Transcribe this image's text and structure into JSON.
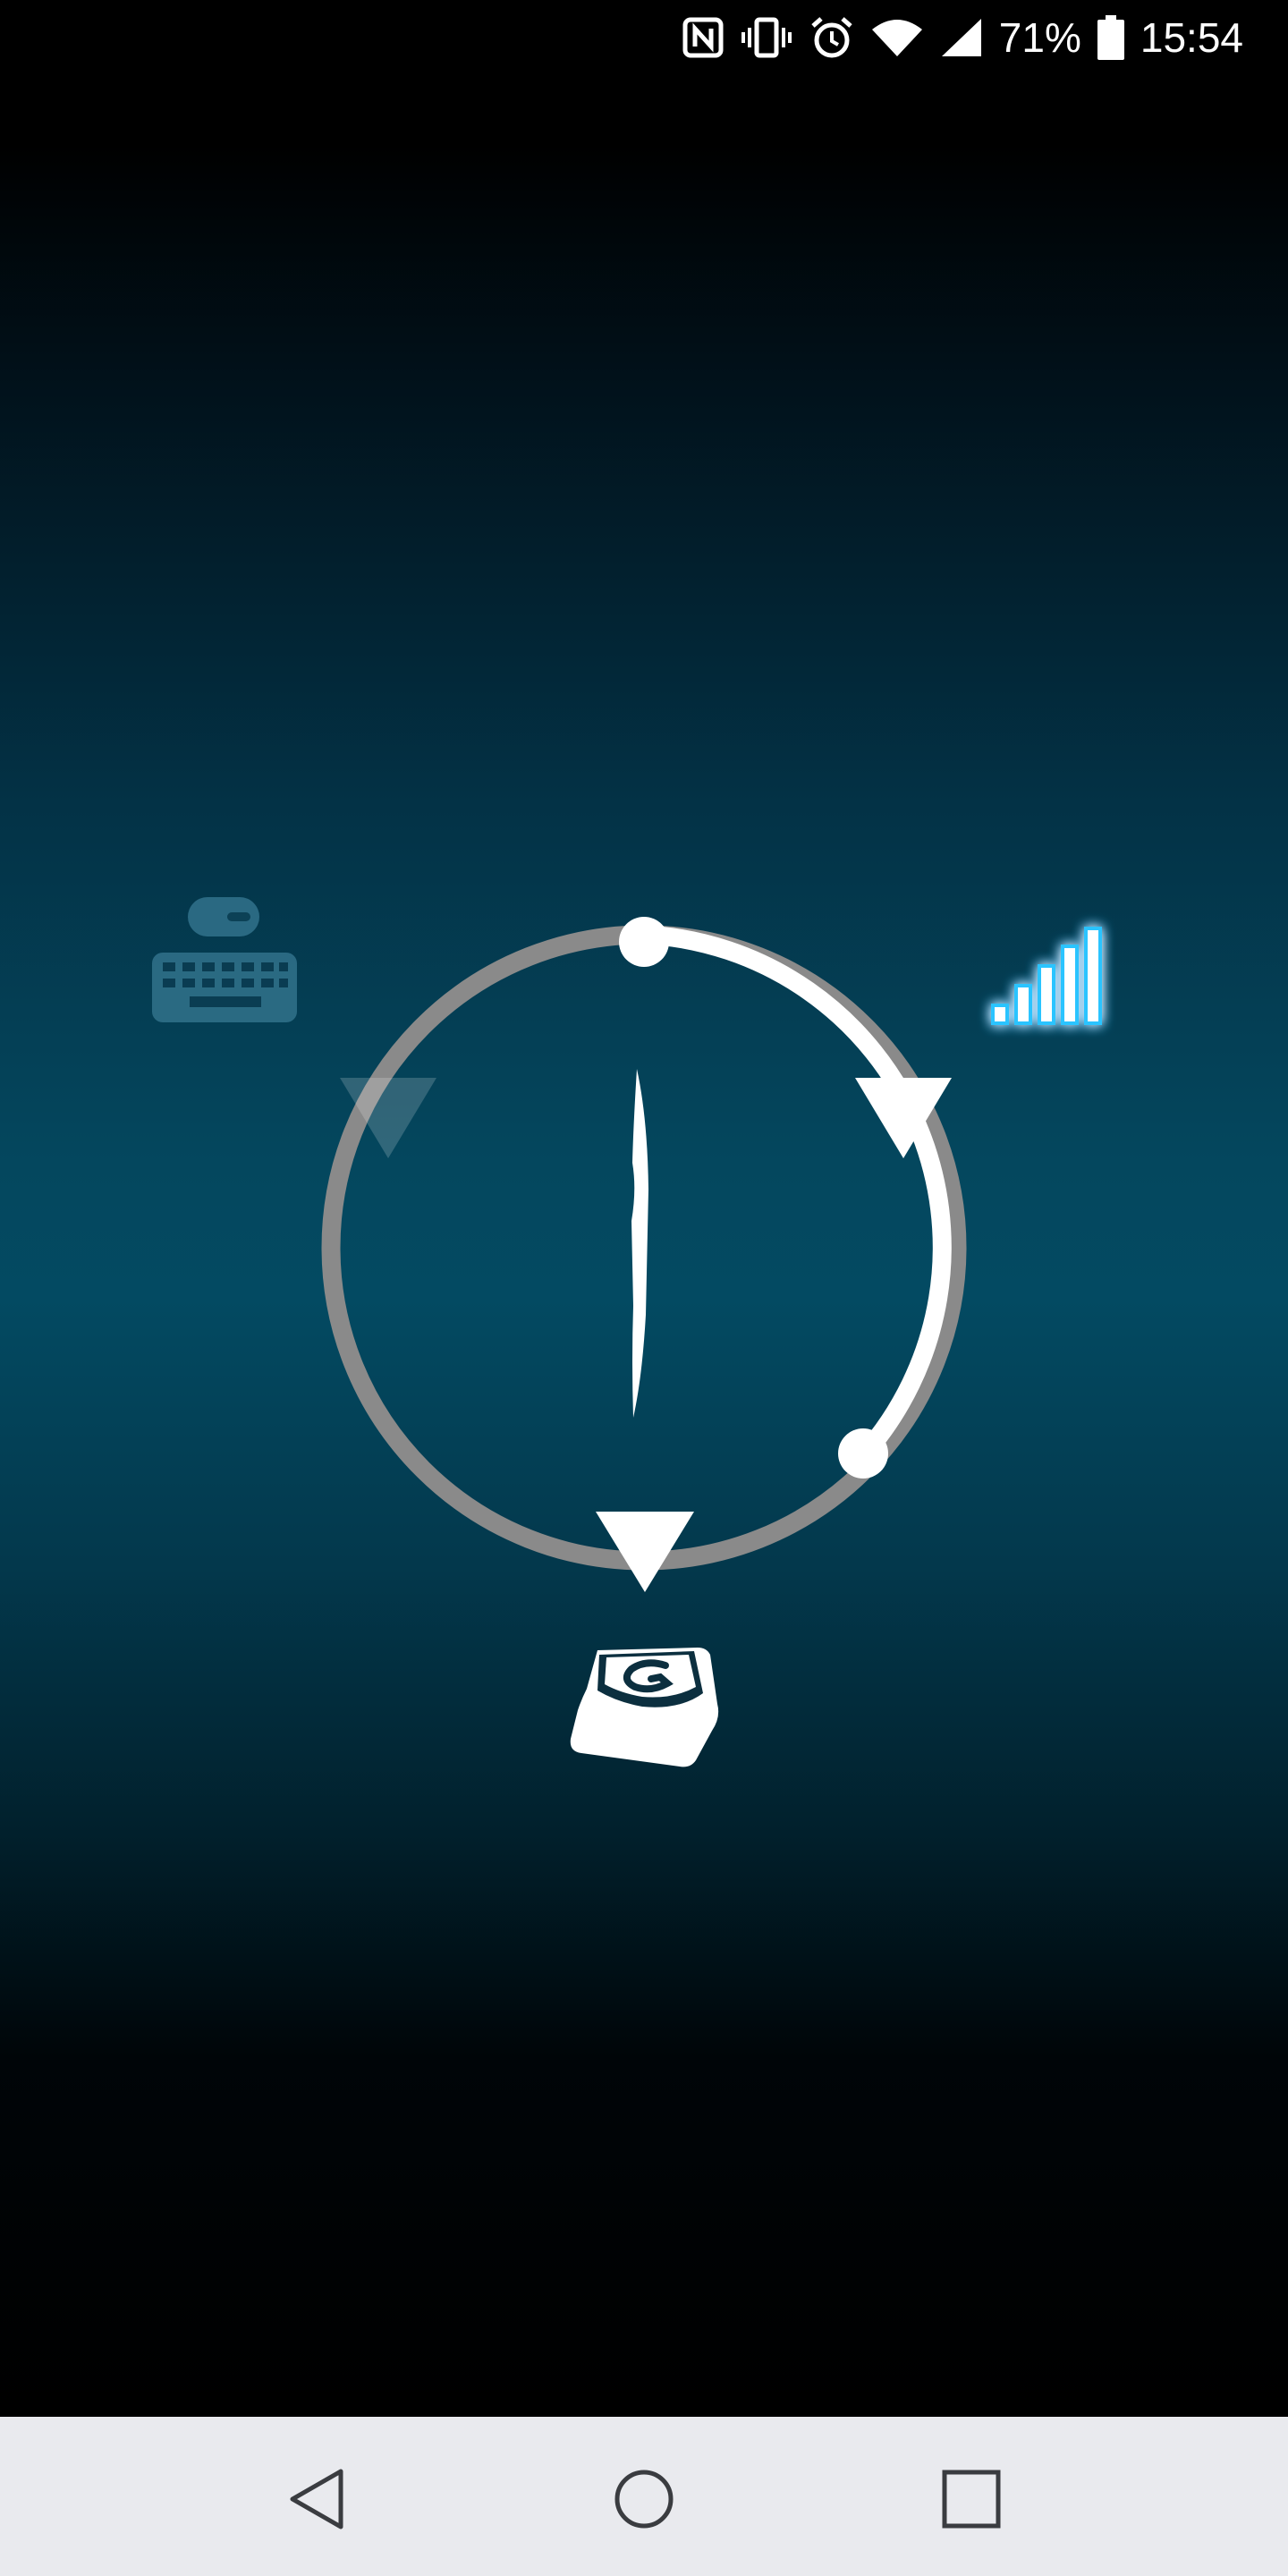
{
  "status_bar": {
    "battery_percent": "71%",
    "time": "15:54",
    "icons": [
      "nfc-icon",
      "vibrate-icon",
      "alarm-icon",
      "wifi-icon",
      "cell-signal-icon",
      "battery-icon"
    ]
  },
  "mode_selector": {
    "modes": [
      {
        "name": "keyboard-mouse-icon",
        "state": "inactive"
      },
      {
        "name": "signal-bars-icon",
        "state": "active"
      },
      {
        "name": "g-key-icon",
        "state": "active"
      }
    ],
    "ring_progress": 0.37,
    "colors": {
      "ring_active": "#ffffff",
      "ring_inactive": "#8a8a8a",
      "signal_glow": "#29c4ff",
      "keyboard_inactive": "#2f6f88"
    }
  },
  "nav_bar": {
    "buttons": [
      "back-icon",
      "home-icon",
      "recents-icon"
    ]
  }
}
